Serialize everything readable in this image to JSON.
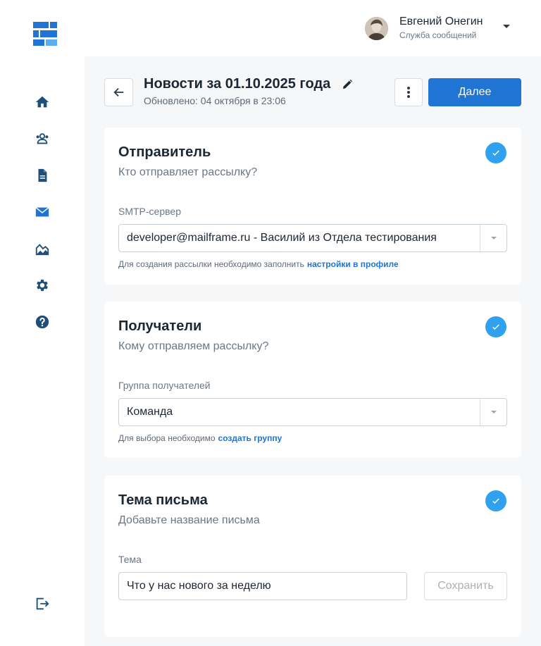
{
  "colors": {
    "accent": "#1f74d4",
    "check": "#2fa1ee",
    "main_bg": "#f5f7f9",
    "icon": "#1e4f78"
  },
  "header": {
    "user_name": "Евгений Онегин",
    "user_role": "Служба сообщений"
  },
  "sidebar": {
    "items": [
      {
        "icon": "home-icon"
      },
      {
        "icon": "users-icon"
      },
      {
        "icon": "document-icon"
      },
      {
        "icon": "mail-icon"
      },
      {
        "icon": "chart-icon"
      },
      {
        "icon": "gear-icon"
      },
      {
        "icon": "help-icon"
      }
    ],
    "bottom": {
      "icon": "logout-icon"
    }
  },
  "page": {
    "title": "Новости за 01.10.2025 года",
    "updated": "Обновлено: 04 октября в 23:06",
    "next_label": "Далее"
  },
  "sender": {
    "title": "Отправитель",
    "subtitle": "Кто отправляет рассылку?",
    "field_label": "SMTP-сервер",
    "value": "developer@mailframe.ru - Василий из Отдела тестирования",
    "hint": "Для создания рассылки необходимо заполнить",
    "hint_link": "настройки в профиле"
  },
  "recipients": {
    "title": "Получатели",
    "subtitle": "Кому отправляем рассылку?",
    "field_label": "Группа получателей",
    "value": "Команда",
    "hint": "Для выбора необходимо",
    "hint_link": "создать группу"
  },
  "subject": {
    "title": "Тема письма",
    "subtitle": "Добавьте название письма",
    "field_label": "Тема",
    "value": "Что у нас нового за неделю",
    "save_label": "Сохранить"
  }
}
